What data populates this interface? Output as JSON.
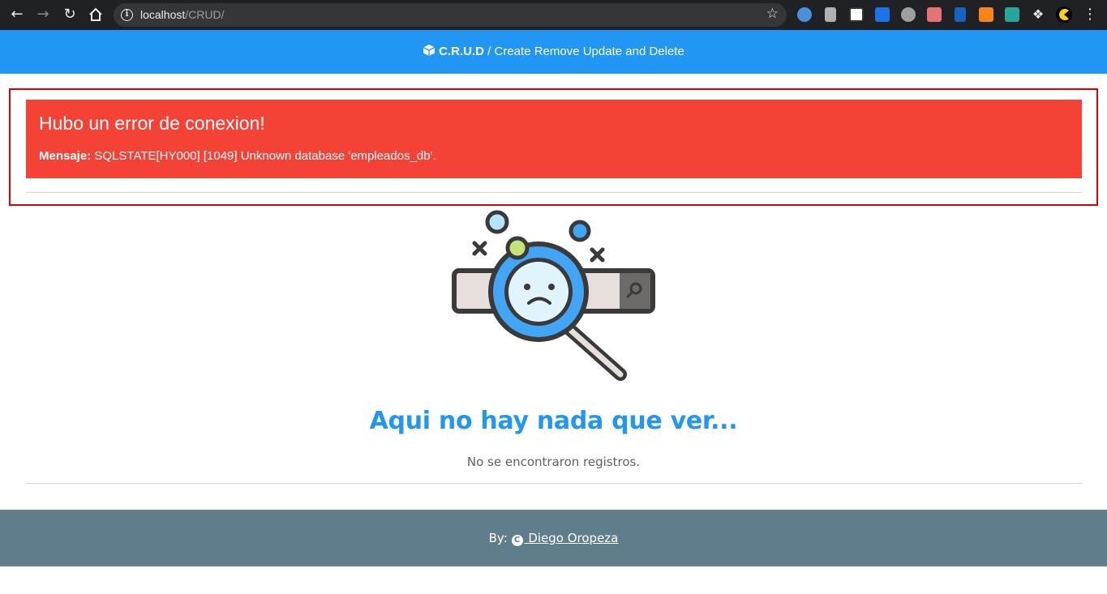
{
  "browser": {
    "url_host": "localhost",
    "url_path": "/CRUD/",
    "back_icon": "arrow-left-icon",
    "forward_icon": "arrow-right-icon",
    "reload_icon": "reload-icon",
    "home_icon": "home-icon",
    "star_icon": "star-icon"
  },
  "header": {
    "brand": "C.R.U.D",
    "separator": " / ",
    "subtitle": "Create Remove Update and Delete",
    "icon": "cube-icon",
    "bg_color": "#2196f3"
  },
  "error": {
    "title": "Hubo un error de conexion!",
    "label": "Mensaje:",
    "message": " SQLSTATE[HY000] [1049] Unknown database 'empleados_db'.",
    "bg_color": "#f44336"
  },
  "empty_state": {
    "title": "Aqui no hay nada que ver...",
    "subtitle": "No se encontraron registros.",
    "illustration": "sad-magnifier-search-icon"
  },
  "footer": {
    "by_label": "By:",
    "author": " Diego Oropeza",
    "icon": "copyright-icon",
    "bg_color": "#607d8b"
  }
}
